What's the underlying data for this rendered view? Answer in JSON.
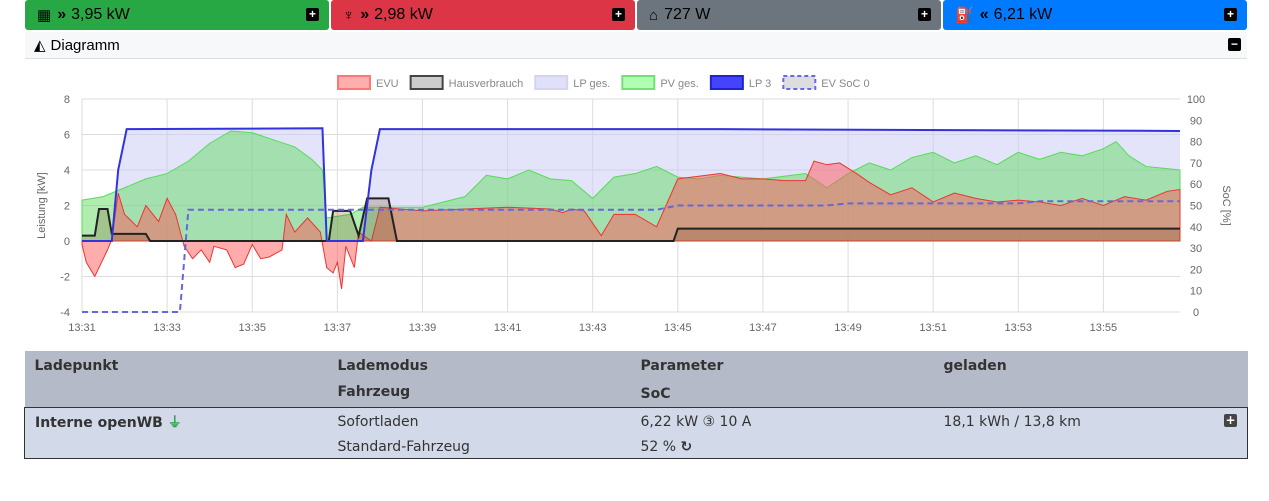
{
  "tiles": [
    {
      "icon": "solar-panel-icon",
      "arrows": "»",
      "value": "3,95 kW",
      "color": "#28a745"
    },
    {
      "icon": "grid-tower-icon",
      "arrows": "»",
      "value": "2,98 kW",
      "color": "#dc3545"
    },
    {
      "icon": "home-icon",
      "arrows": "",
      "value": "727 W",
      "color": "#6c757d"
    },
    {
      "icon": "charging-station-icon",
      "arrows": "«",
      "value": "6,21 kW",
      "color": "#007bff"
    }
  ],
  "diagram": {
    "title": "Diagramm"
  },
  "chart_data": {
    "type": "area",
    "x_ticks": [
      "13:31",
      "13:33",
      "13:35",
      "13:37",
      "13:39",
      "13:41",
      "13:43",
      "13:45",
      "13:47",
      "13:49",
      "13:51",
      "13:53",
      "13:55"
    ],
    "x_unit": "minutes since 13:31",
    "xlim": [
      0,
      25.8
    ],
    "ylabel": "Leistung [kW]",
    "ylim": [
      -4,
      8
    ],
    "y_ticks": [
      "8",
      "6",
      "4",
      "2",
      "0",
      "-2",
      "-4"
    ],
    "y2label": "SoC [%]",
    "y2lim": [
      0,
      100
    ],
    "y2_ticks": [
      "100",
      "90",
      "80",
      "70",
      "60",
      "50",
      "40",
      "30",
      "20",
      "10",
      "0"
    ],
    "legend_position": "top",
    "series": [
      {
        "name": "EVU",
        "color": "#ff6b6b",
        "axis": "left",
        "points": [
          [
            0,
            -0.2
          ],
          [
            0.1,
            -1.2
          ],
          [
            0.3,
            -2
          ],
          [
            0.6,
            -0.5
          ],
          [
            0.7,
            0.1
          ],
          [
            0.85,
            2.7
          ],
          [
            1,
            1.5
          ],
          [
            1.3,
            0.8
          ],
          [
            1.5,
            2
          ],
          [
            1.8,
            1.1
          ],
          [
            2,
            2.4
          ],
          [
            2.2,
            1.5
          ],
          [
            2.4,
            -0.3
          ],
          [
            2.6,
            -1
          ],
          [
            2.8,
            -0.5
          ],
          [
            3,
            -1.2
          ],
          [
            3.1,
            -0.3
          ],
          [
            3.4,
            -0.5
          ],
          [
            3.6,
            -1.5
          ],
          [
            3.8,
            -1.3
          ],
          [
            4,
            -0.2
          ],
          [
            4.2,
            -1
          ],
          [
            4.4,
            -0.9
          ],
          [
            4.7,
            -0.5
          ],
          [
            4.8,
            1.5
          ],
          [
            5,
            0.5
          ],
          [
            5.3,
            1.3
          ],
          [
            5.6,
            0.5
          ],
          [
            5.75,
            -1.5
          ],
          [
            5.9,
            -1.8
          ],
          [
            6,
            -1.2
          ],
          [
            6.1,
            -2.7
          ],
          [
            6.2,
            -0.3
          ],
          [
            6.4,
            -1.5
          ],
          [
            6.5,
            0.5
          ],
          [
            6.8,
            0
          ],
          [
            7,
            1.9
          ],
          [
            8,
            1.7
          ],
          [
            9,
            1.8
          ],
          [
            10,
            1.9
          ],
          [
            11,
            1.8
          ],
          [
            11.3,
            1.6
          ],
          [
            11.5,
            1.8
          ],
          [
            11.8,
            1.7
          ],
          [
            12.2,
            0.3
          ],
          [
            12.5,
            1.5
          ],
          [
            13,
            1.5
          ],
          [
            13.5,
            0.8
          ],
          [
            14,
            3.5
          ],
          [
            15,
            3.8
          ],
          [
            15.5,
            3.5
          ],
          [
            16,
            3.5
          ],
          [
            16.5,
            3.4
          ],
          [
            17,
            3.4
          ],
          [
            17.2,
            4.5
          ],
          [
            17.5,
            4.3
          ],
          [
            17.8,
            4.4
          ],
          [
            18.2,
            3.8
          ],
          [
            18.5,
            3.3
          ],
          [
            19,
            2.6
          ],
          [
            19.5,
            3
          ],
          [
            20,
            2.2
          ],
          [
            20.5,
            2.7
          ],
          [
            21,
            2.4
          ],
          [
            21.5,
            2.2
          ],
          [
            22,
            2.3
          ],
          [
            22.5,
            2.2
          ],
          [
            23,
            2
          ],
          [
            23.5,
            2.4
          ],
          [
            24,
            2
          ],
          [
            24.5,
            2.5
          ],
          [
            25,
            2.3
          ],
          [
            25.5,
            2.8
          ],
          [
            25.8,
            2.9
          ]
        ]
      },
      {
        "name": "Hausverbrauch",
        "color": "#333333",
        "axis": "left",
        "points": [
          [
            0,
            0.3
          ],
          [
            0.3,
            0.3
          ],
          [
            0.4,
            1.8
          ],
          [
            0.6,
            1.8
          ],
          [
            0.7,
            0.4
          ],
          [
            1.5,
            0.4
          ],
          [
            1.6,
            0
          ],
          [
            5.8,
            0
          ],
          [
            5.9,
            1.7
          ],
          [
            6.3,
            1.7
          ],
          [
            6.5,
            0.3
          ],
          [
            6.7,
            2.4
          ],
          [
            7.2,
            2.4
          ],
          [
            7.4,
            0
          ],
          [
            13.9,
            0
          ],
          [
            14,
            0.7
          ],
          [
            25.8,
            0.7
          ]
        ]
      },
      {
        "name": "LP ges.",
        "color": "#c8c8f5",
        "axis": "left",
        "points": [
          [
            0,
            0
          ],
          [
            0.7,
            0
          ],
          [
            0.85,
            4
          ],
          [
            1.05,
            6.3
          ],
          [
            5.65,
            6.35
          ],
          [
            5.75,
            0
          ],
          [
            6.6,
            0
          ],
          [
            6.8,
            4
          ],
          [
            7,
            6.3
          ],
          [
            15,
            6.3
          ],
          [
            25.8,
            6.2
          ]
        ]
      },
      {
        "name": "PV ges.",
        "color": "#66dd66",
        "axis": "left",
        "points": [
          [
            0,
            2.3
          ],
          [
            0.5,
            2.5
          ],
          [
            1,
            3
          ],
          [
            1.5,
            3.5
          ],
          [
            2,
            3.8
          ],
          [
            2.5,
            4.5
          ],
          [
            3,
            5.5
          ],
          [
            3.5,
            6.2
          ],
          [
            4,
            6.1
          ],
          [
            4.5,
            5.7
          ],
          [
            5,
            5.3
          ],
          [
            5.4,
            4.6
          ],
          [
            5.65,
            4
          ],
          [
            5.75,
            1.3
          ],
          [
            6.3,
            1.5
          ],
          [
            6.6,
            1.9
          ],
          [
            7.5,
            1.9
          ],
          [
            8,
            1.9
          ],
          [
            9,
            2.5
          ],
          [
            9.5,
            3.7
          ],
          [
            10,
            3.5
          ],
          [
            10.5,
            4
          ],
          [
            11,
            3.5
          ],
          [
            11.5,
            3.4
          ],
          [
            12,
            2.4
          ],
          [
            12.5,
            3.6
          ],
          [
            13,
            3.8
          ],
          [
            13.5,
            4.2
          ],
          [
            14,
            3.6
          ],
          [
            14.5,
            3.5
          ],
          [
            15,
            3.7
          ],
          [
            16,
            3.5
          ],
          [
            17,
            3.8
          ],
          [
            17.5,
            3
          ],
          [
            18,
            3.8
          ],
          [
            18.5,
            4.4
          ],
          [
            19,
            4
          ],
          [
            19.5,
            4.7
          ],
          [
            20,
            5
          ],
          [
            20.5,
            4.4
          ],
          [
            21,
            4.8
          ],
          [
            21.5,
            4.3
          ],
          [
            22,
            5
          ],
          [
            22.5,
            4.6
          ],
          [
            23,
            5
          ],
          [
            23.5,
            4.8
          ],
          [
            24,
            5.2
          ],
          [
            24.3,
            5.6
          ],
          [
            24.6,
            4.8
          ],
          [
            25,
            4.2
          ],
          [
            25.8,
            4
          ]
        ]
      },
      {
        "name": "LP 3",
        "color": "#3333dd",
        "axis": "left",
        "points": [
          [
            0,
            0
          ],
          [
            0.7,
            0
          ],
          [
            0.85,
            4
          ],
          [
            1.05,
            6.3
          ],
          [
            5.65,
            6.35
          ],
          [
            5.75,
            0
          ],
          [
            6.6,
            0
          ],
          [
            6.8,
            4
          ],
          [
            7,
            6.3
          ],
          [
            15,
            6.3
          ],
          [
            25.8,
            6.2
          ]
        ]
      },
      {
        "name": "EV SoC 0",
        "color": "#6666dd",
        "axis": "right",
        "dashed": true,
        "points": [
          [
            0,
            0
          ],
          [
            2.3,
            0
          ],
          [
            2.5,
            48
          ],
          [
            13.5,
            48
          ],
          [
            14,
            50
          ],
          [
            17.5,
            50
          ],
          [
            18,
            51
          ],
          [
            22,
            51
          ],
          [
            22.5,
            52
          ],
          [
            25.8,
            52
          ]
        ]
      }
    ]
  },
  "table": {
    "headers": [
      [
        "Ladepunkt",
        ""
      ],
      [
        "Lademodus",
        "Fahrzeug"
      ],
      [
        "Parameter",
        "SoC"
      ],
      [
        "geladen",
        ""
      ]
    ],
    "row": {
      "name": "Interne openWB",
      "mode": "Sofortladen",
      "vehicle": "Standard-Fahrzeug",
      "power": "6,22 kW",
      "phases": "③",
      "current": "10 A",
      "soc": "52 %",
      "charged": "18,1 kWh / 13,8 km"
    }
  }
}
